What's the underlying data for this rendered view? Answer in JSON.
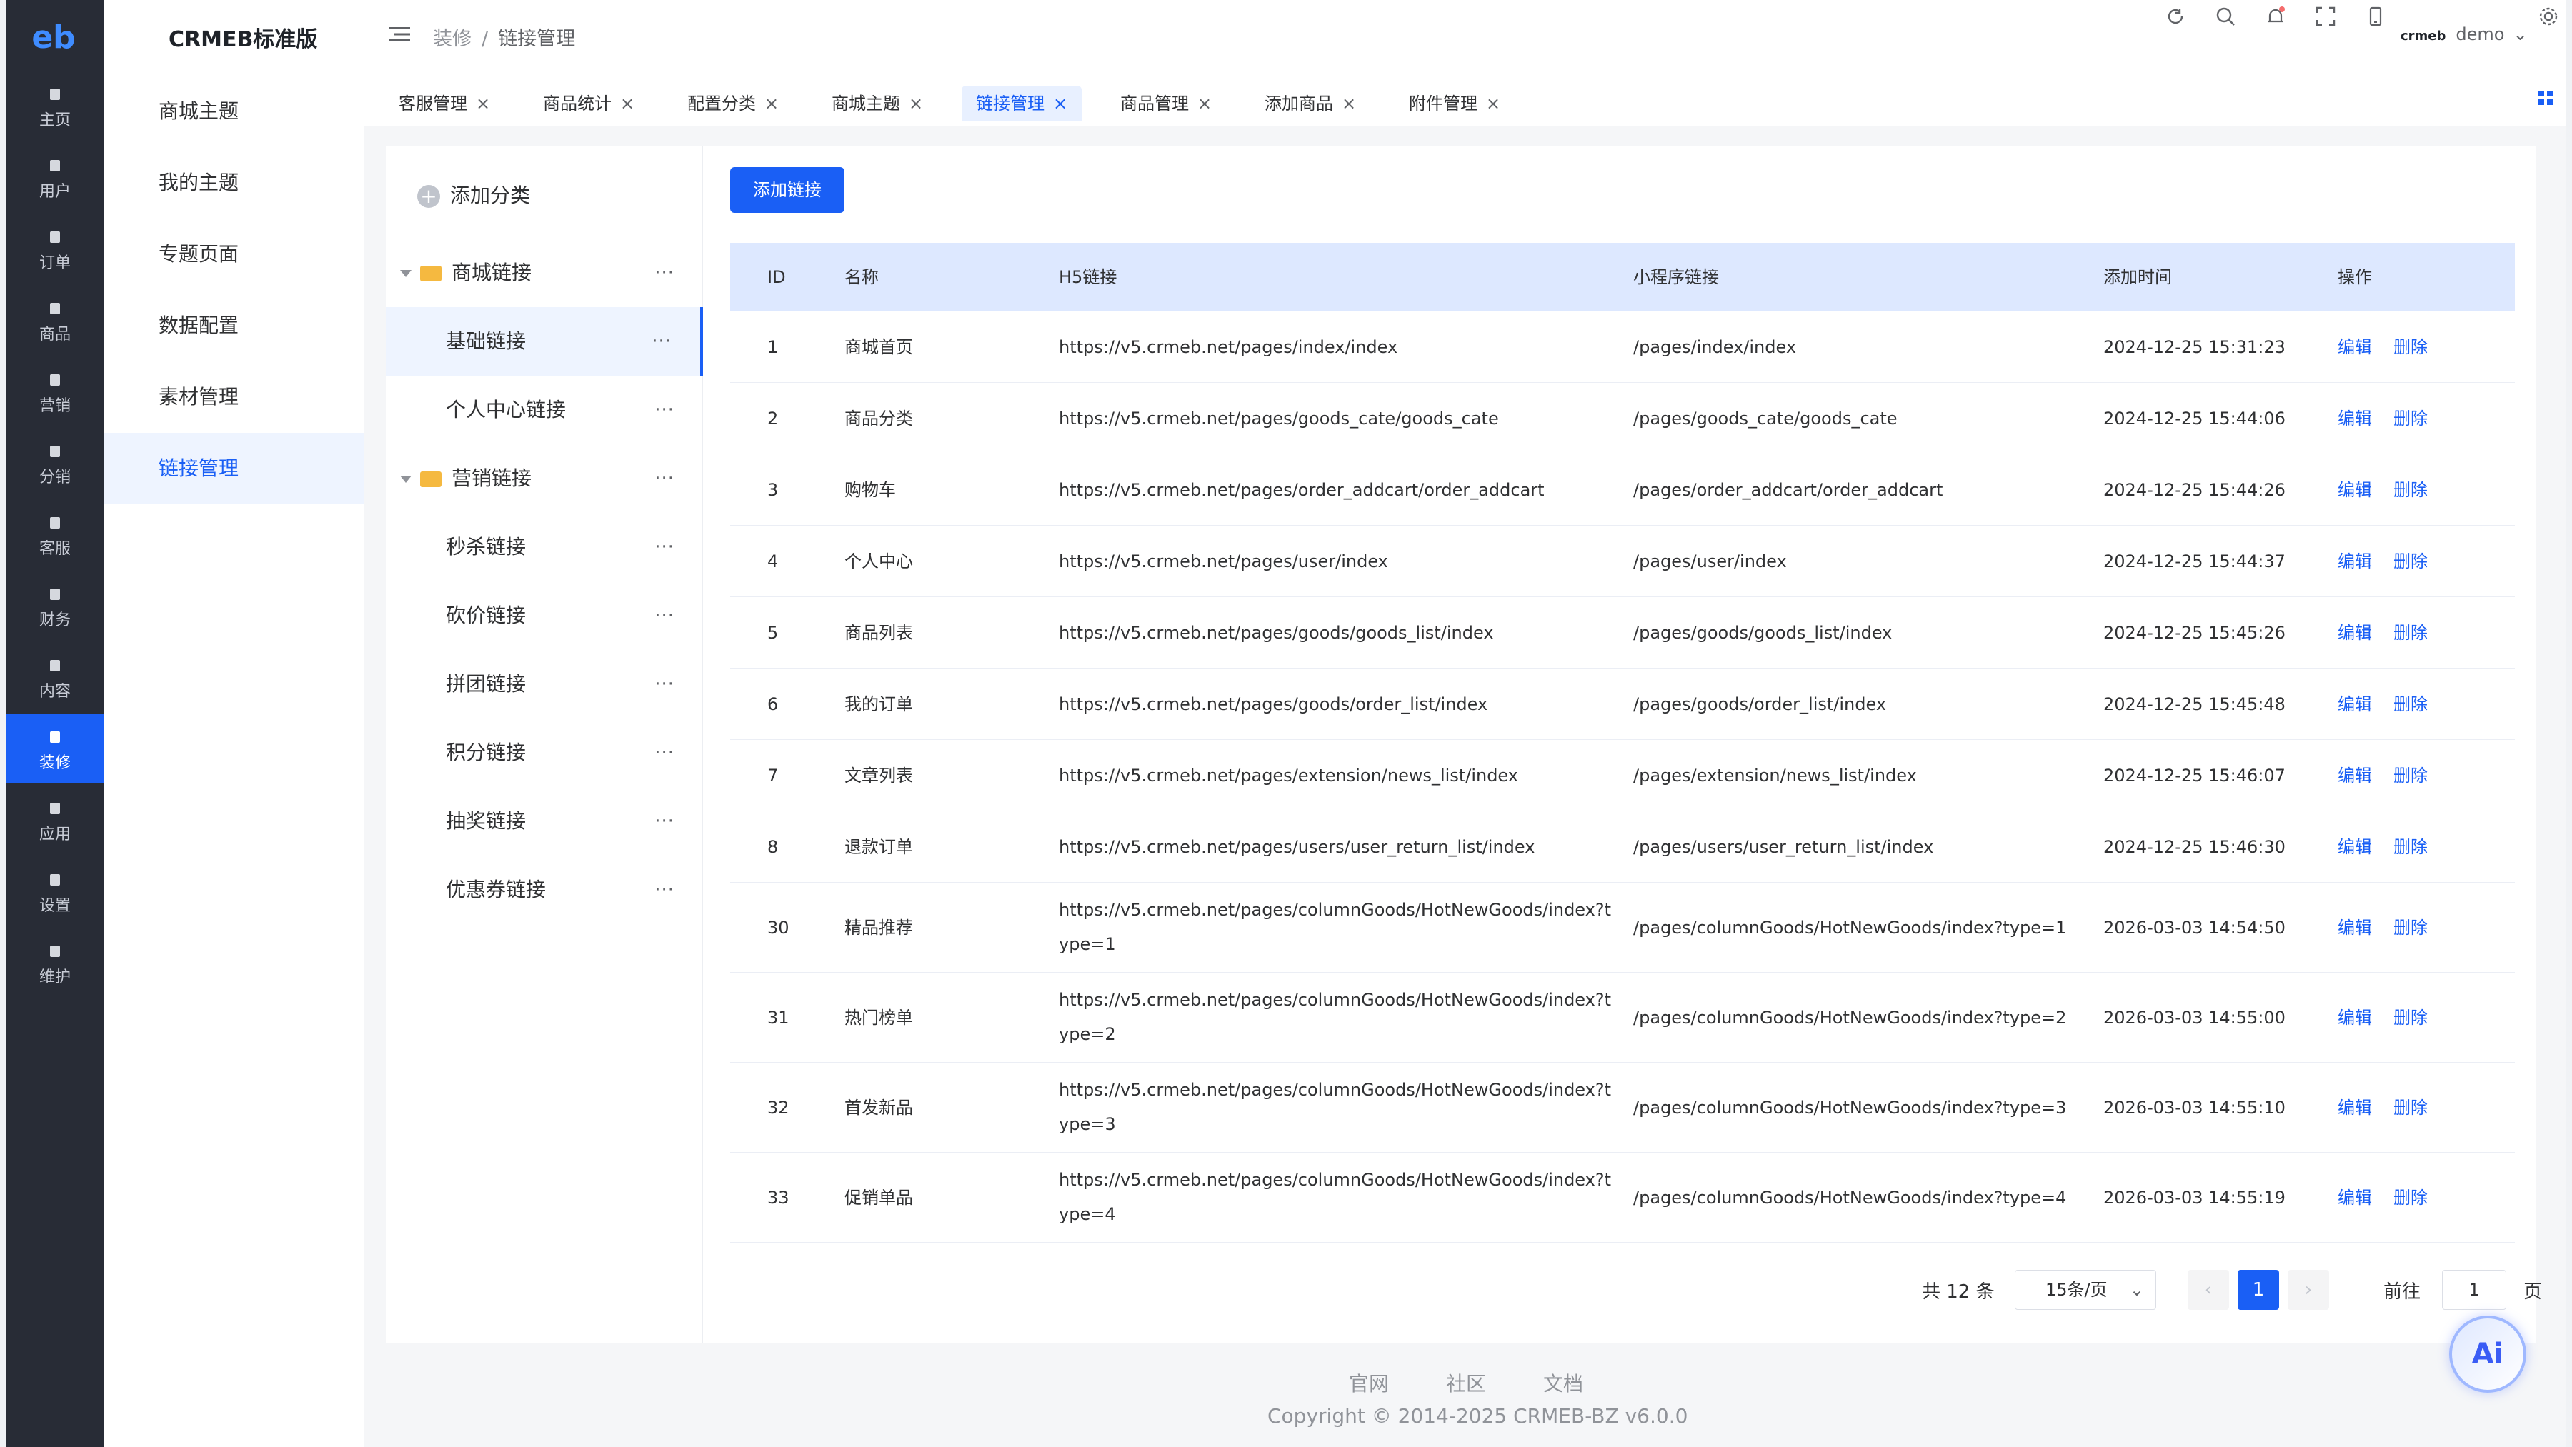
{
  "app": {
    "logo": "eb",
    "brand": "CRMEB标准版"
  },
  "nav": {
    "items": [
      {
        "label": "主页",
        "icon": "home-icon"
      },
      {
        "label": "用户",
        "icon": "user-icon"
      },
      {
        "label": "订单",
        "icon": "order-icon"
      },
      {
        "label": "商品",
        "icon": "product-icon"
      },
      {
        "label": "营销",
        "icon": "marketing-icon"
      },
      {
        "label": "分销",
        "icon": "distribution-icon"
      },
      {
        "label": "客服",
        "icon": "service-icon"
      },
      {
        "label": "财务",
        "icon": "finance-icon"
      },
      {
        "label": "内容",
        "icon": "content-icon"
      },
      {
        "label": "装修",
        "icon": "decoration-icon",
        "active": true
      },
      {
        "label": "应用",
        "icon": "apps-icon"
      },
      {
        "label": "设置",
        "icon": "settings-icon"
      },
      {
        "label": "维护",
        "icon": "maintenance-icon"
      }
    ]
  },
  "sub_sidebar": {
    "items": [
      "商城主题",
      "我的主题",
      "专题页面",
      "数据配置",
      "素材管理",
      "链接管理"
    ],
    "active": "链接管理"
  },
  "header": {
    "breadcrumb": [
      "装修",
      "链接管理"
    ],
    "user": "demo",
    "user_brand": "crmeb"
  },
  "tabs": [
    {
      "label": "客服管理"
    },
    {
      "label": "商品统计"
    },
    {
      "label": "配置分类"
    },
    {
      "label": "商城主题"
    },
    {
      "label": "链接管理",
      "active": true
    },
    {
      "label": "商品管理"
    },
    {
      "label": "添加商品"
    },
    {
      "label": "附件管理"
    }
  ],
  "tree": {
    "add_label": "添加分类",
    "groups": [
      {
        "label": "商城链接",
        "children": [
          "基础链接",
          "个人中心链接"
        ]
      },
      {
        "label": "营销链接",
        "children": [
          "秒杀链接",
          "砍价链接",
          "拼团链接",
          "积分链接",
          "抽奖链接",
          "优惠券链接"
        ]
      }
    ],
    "active": "基础链接"
  },
  "toolbar": {
    "add_link": "添加链接"
  },
  "table": {
    "headers": [
      "ID",
      "名称",
      "H5链接",
      "小程序链接",
      "添加时间",
      "操作"
    ],
    "edit_label": "编辑",
    "delete_label": "删除",
    "rows": [
      {
        "id": "1",
        "name": "商城首页",
        "h5": "https://v5.crmeb.net/pages/index/index",
        "mp": "/pages/index/index",
        "time": "2024-12-25 15:31:23"
      },
      {
        "id": "2",
        "name": "商品分类",
        "h5": "https://v5.crmeb.net/pages/goods_cate/goods_cate",
        "mp": "/pages/goods_cate/goods_cate",
        "time": "2024-12-25 15:44:06"
      },
      {
        "id": "3",
        "name": "购物车",
        "h5": "https://v5.crmeb.net/pages/order_addcart/order_addcart",
        "mp": "/pages/order_addcart/order_addcart",
        "time": "2024-12-25 15:44:26"
      },
      {
        "id": "4",
        "name": "个人中心",
        "h5": "https://v5.crmeb.net/pages/user/index",
        "mp": "/pages/user/index",
        "time": "2024-12-25 15:44:37"
      },
      {
        "id": "5",
        "name": "商品列表",
        "h5": "https://v5.crmeb.net/pages/goods/goods_list/index",
        "mp": "/pages/goods/goods_list/index",
        "time": "2024-12-25 15:45:26"
      },
      {
        "id": "6",
        "name": "我的订单",
        "h5": "https://v5.crmeb.net/pages/goods/order_list/index",
        "mp": "/pages/goods/order_list/index",
        "time": "2024-12-25 15:45:48"
      },
      {
        "id": "7",
        "name": "文章列表",
        "h5": "https://v5.crmeb.net/pages/extension/news_list/index",
        "mp": "/pages/extension/news_list/index",
        "time": "2024-12-25 15:46:07"
      },
      {
        "id": "8",
        "name": "退款订单",
        "h5": "https://v5.crmeb.net/pages/users/user_return_list/index",
        "mp": "/pages/users/user_return_list/index",
        "time": "2024-12-25 15:46:30"
      },
      {
        "id": "30",
        "name": "精品推荐",
        "h5": "https://v5.crmeb.net/pages/columnGoods/HotNewGoods/index?type=1",
        "mp": "/pages/columnGoods/HotNewGoods/index?type=1",
        "time": "2026-03-03 14:54:50"
      },
      {
        "id": "31",
        "name": "热门榜单",
        "h5": "https://v5.crmeb.net/pages/columnGoods/HotNewGoods/index?type=2",
        "mp": "/pages/columnGoods/HotNewGoods/index?type=2",
        "time": "2026-03-03 14:55:00"
      },
      {
        "id": "32",
        "name": "首发新品",
        "h5": "https://v5.crmeb.net/pages/columnGoods/HotNewGoods/index?type=3",
        "mp": "/pages/columnGoods/HotNewGoods/index?type=3",
        "time": "2026-03-03 14:55:10"
      },
      {
        "id": "33",
        "name": "促销单品",
        "h5": "https://v5.crmeb.net/pages/columnGoods/HotNewGoods/index?type=4",
        "mp": "/pages/columnGoods/HotNewGoods/index?type=4",
        "time": "2026-03-03 14:55:19"
      }
    ]
  },
  "pagination": {
    "total": "共 12 条",
    "page_size": "15条/页",
    "current": "1",
    "goto": "前往",
    "goto_value": "1",
    "page_unit": "页",
    "prev": "‹",
    "next": "›"
  },
  "footer": {
    "links": [
      "官网",
      "社区",
      "文档"
    ],
    "copyright": "Copyright © 2014-2025 CRMEB-BZ v6.0.0"
  },
  "ai_badge": "Ai",
  "colors": {
    "primary": "#1a5ff5",
    "nav_bg": "#282c36",
    "table_header": "#dde8ff"
  }
}
